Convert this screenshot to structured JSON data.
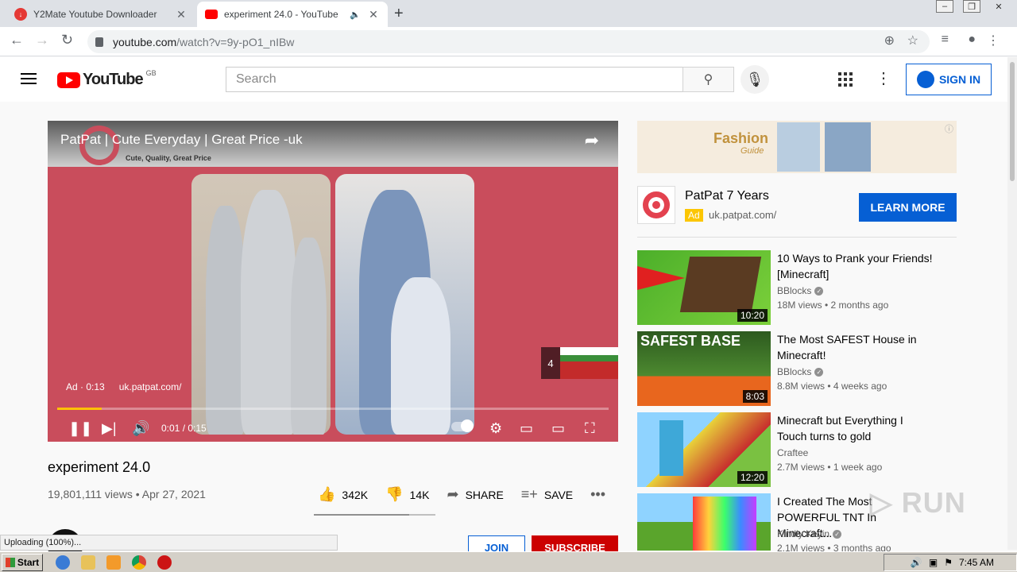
{
  "browser": {
    "tabs": [
      {
        "title": "Y2Mate Youtube Downloader",
        "active": false
      },
      {
        "title": "experiment 24.0 - YouTube",
        "active": true
      }
    ],
    "url_domain": "youtube.com",
    "url_path": "/watch?v=9y-pO1_nIBw"
  },
  "header": {
    "logo": "YouTube",
    "region": "GB",
    "search_placeholder": "Search",
    "signin_label": "SIGN IN"
  },
  "player": {
    "ad_title": "PatPat | Cute Everyday | Great Price -uk",
    "ad_tagline": "Cute, Quality, Great Price",
    "ad_info": "Ad · 0:13",
    "ad_url": "uk.patpat.com/",
    "skip_countdown": "4",
    "time": "0:01 / 0:15",
    "progress_fraction": 0.08
  },
  "video": {
    "title": "experiment 24.0",
    "meta": "19,801,111 views • Apr 27, 2021",
    "likes": "342K",
    "dislikes": "14K",
    "share_label": "SHARE",
    "save_label": "SAVE",
    "join_label": "JOIN",
    "subscribe_label": "SUBSCRIBE"
  },
  "sidebar_ad": {
    "banner_text": "Fashion",
    "banner_sub": "Guide",
    "name": "PatPat 7 Years",
    "badge": "Ad",
    "url": "uk.patpat.com/",
    "cta": "LEARN MORE"
  },
  "recommendations": [
    {
      "title": "10 Ways to Prank your Friends! [Minecraft]",
      "channel": "BBlocks",
      "meta": "18M views • 2 months ago",
      "duration": "10:20"
    },
    {
      "title": "The Most SAFEST House in Minecraft!",
      "channel": "BBlocks",
      "meta": "8.8M views • 4 weeks ago",
      "duration": "8:03",
      "thumb_text": "SAFEST BASE"
    },
    {
      "title": "Minecraft but Everything I Touch turns to gold",
      "channel": "Craftee",
      "meta": "2.7M views • 1 week ago",
      "duration": "12:20"
    },
    {
      "title": "I Created The Most POWERFUL TNT In Minecraft...",
      "channel": "Kindly Keyin",
      "meta": "2.1M views • 3 months ago",
      "duration": ""
    }
  ],
  "watermark": "RUN",
  "statusbar": "Uploading (100%)...",
  "taskbar": {
    "start": "Start",
    "time": "7:45 AM"
  },
  "colors": {
    "yt_red": "#ff0000",
    "blue": "#065fd4",
    "ad_yellow": "#fcc603",
    "progress_yellow": "#ffc107"
  }
}
